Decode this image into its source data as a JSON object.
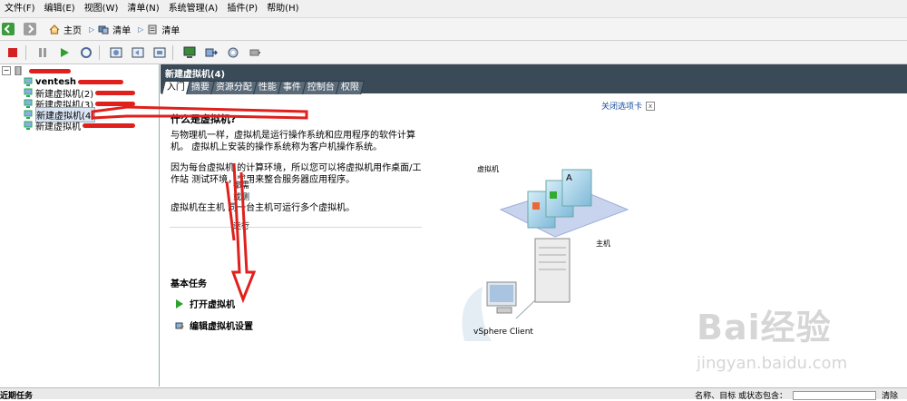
{
  "menubar": {
    "items": [
      "文件(F)",
      "编辑(E)",
      "视图(W)",
      "清单(N)",
      "系统管理(A)",
      "插件(P)",
      "帮助(H)"
    ]
  },
  "navbar": {
    "home_label": "主页",
    "crumb1": "清单",
    "crumb2": "清单"
  },
  "tree": {
    "root_label": "",
    "items": [
      {
        "label": "ventesh"
      },
      {
        "label": "新建虚拟机(2)"
      },
      {
        "label": "新建虚拟机(3)"
      },
      {
        "label": "新建虚拟机(4)"
      },
      {
        "label": "新建虚拟机"
      }
    ]
  },
  "pane": {
    "title": "新建虚拟机(4)",
    "tabs": [
      "入门",
      "摘要",
      "资源分配",
      "性能",
      "事件",
      "控制台",
      "权限"
    ],
    "close_tab": "关闭选项卡"
  },
  "content": {
    "heading": "什么是虚拟机?",
    "para1": "与物理机一样，虚拟机是运行操作系统和应用程序的软件计算机。 虚拟机上安装的操作系统称为客户机操作系统。",
    "para2": "因为每台虚拟机         的计算环境，所以您可以将虚拟机用作桌面/工作站       测试环境，或用来整合服务器应用程序。",
    "para3": "虚拟机在主机         同一台主机可运行多个虚拟机。",
    "fragments": [
      "都需",
      "或测",
      "运行"
    ],
    "tasks_heading": "基本任务",
    "task1": "打开虚拟机",
    "task2": "编辑虚拟机设置",
    "diag_vm_label": "虚拟机",
    "diag_host_label": "主机",
    "diag_client_label": "vSphere Client"
  },
  "statusbar": {
    "left": "近期任务",
    "right_label": "名称、目标 或状态包含：",
    "clear": "清除"
  },
  "watermark": {
    "brand": "Bai经验",
    "url": "jingyan.baidu.com"
  },
  "colors": {
    "pane_header": "#3a4a57",
    "annotation_red": "#e0201c",
    "link_blue": "#1a4fa0"
  }
}
